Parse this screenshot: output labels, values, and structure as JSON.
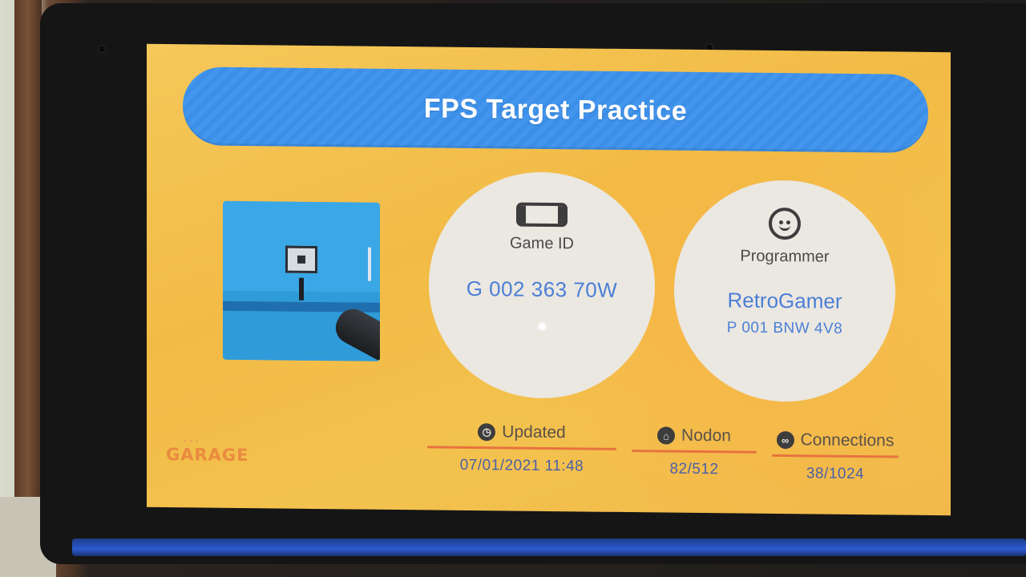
{
  "title": "FPS Target Practice",
  "game": {
    "label": "Game ID",
    "value": "G 002 363 70W",
    "icon": "console-icon"
  },
  "programmer": {
    "label": "Programmer",
    "name": "RetroGamer",
    "id": "P 001 BNW 4V8",
    "icon": "smiley-face-icon"
  },
  "stats": {
    "updated": {
      "label": "Updated",
      "value": "07/01/2021 11:48",
      "icon": "clock-icon"
    },
    "nodon": {
      "label": "Nodon",
      "value": "82/512",
      "icon": "house-icon"
    },
    "connections": {
      "label": "Connections",
      "value": "38/1024",
      "icon": "link-icon"
    }
  },
  "logo": {
    "text": "GARAGE"
  },
  "colors": {
    "background": "#f2bb45",
    "title_bar": "#3c8fe8",
    "value_text": "#4b7fd6",
    "accent_line": "#e7733e",
    "circle": "#ebe7e1"
  }
}
